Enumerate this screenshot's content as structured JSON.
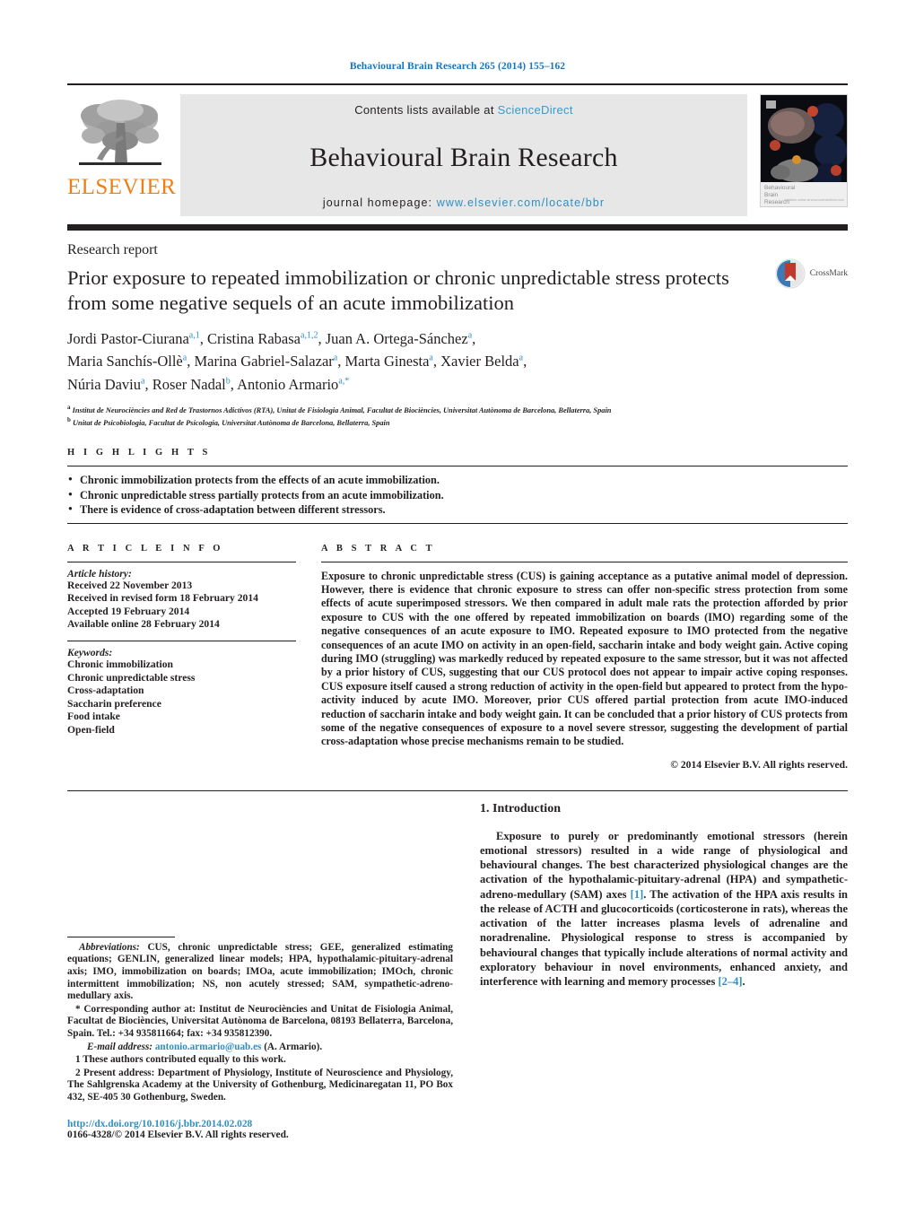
{
  "running_head": "Behavioural Brain Research 265 (2014) 155–162",
  "masthead": {
    "publisher_name": "ELSEVIER",
    "contents_prefix": "Contents lists available at ",
    "contents_link": "ScienceDirect",
    "journal_name": "Behavioural Brain Research",
    "homepage_prefix": "journal homepage: ",
    "homepage_url": "www.elsevier.com/locate/bbr",
    "cover_caption_line1": "Behavioural",
    "cover_caption_line2": "Brain",
    "cover_caption_line3": "Research",
    "cover_caption_tiny": "available online at www.sciencedirect.com"
  },
  "article": {
    "doc_type": "Research report",
    "title": "Prior exposure to repeated immobilization or chronic unpredictable stress protects from some negative sequels of an acute immobilization",
    "crossmark_label": "CrossMark",
    "authors": [
      {
        "name": "Jordi Pastor-Ciurana",
        "marks": "a,1",
        "sep": ", "
      },
      {
        "name": "Cristina Rabasa",
        "marks": "a,1,2",
        "sep": ", "
      },
      {
        "name": "Juan A. Ortega-Sánchez",
        "marks": "a",
        "sep": ","
      },
      {
        "name": "Maria Sanchís-Ollè",
        "marks": "a",
        "sep": ", "
      },
      {
        "name": "Marina Gabriel-Salazar",
        "marks": "a",
        "sep": ", "
      },
      {
        "name": "Marta Ginesta",
        "marks": "a",
        "sep": ", "
      },
      {
        "name": "Xavier Belda",
        "marks": "a",
        "sep": ","
      },
      {
        "name": "Núria Daviu",
        "marks": "a",
        "sep": ", "
      },
      {
        "name": "Roser Nadal",
        "marks": "b",
        "sep": ", "
      },
      {
        "name": "Antonio Armario",
        "marks": "a,*",
        "sep": ""
      }
    ],
    "affiliations": [
      {
        "mark": "a",
        "text": "Institut de Neurociències and Red de Trastornos Adictivos (RTA), Unitat de Fisiologia Animal, Facultat de Biociències, Universitat Autònoma de Barcelona, Bellaterra, Spain"
      },
      {
        "mark": "b",
        "text": "Unitat de Psicobiologia, Facultat de Psicologia, Universitat Autònoma de Barcelona, Bellaterra, Spain"
      }
    ]
  },
  "highlights": {
    "heading": "H I G H L I G H T S",
    "items": [
      "Chronic immobilization protects from the effects of an acute immobilization.",
      "Chronic unpredictable stress partially protects from an acute immobilization.",
      "There is evidence of cross-adaptation between different stressors."
    ]
  },
  "article_info": {
    "heading": "A R T I C L E   I N F O",
    "history_title": "Article history:",
    "history": [
      "Received 22 November 2013",
      "Received in revised form 18 February 2014",
      "Accepted 19 February 2014",
      "Available online 28 February 2014"
    ],
    "keywords_title": "Keywords:",
    "keywords": [
      "Chronic immobilization",
      "Chronic unpredictable stress",
      "Cross-adaptation",
      "Saccharin preference",
      "Food intake",
      "Open-field"
    ]
  },
  "abstract": {
    "heading": "A B S T R A C T",
    "text": "Exposure to chronic unpredictable stress (CUS) is gaining acceptance as a putative animal model of depression. However, there is evidence that chronic exposure to stress can offer non-specific stress protection from some effects of acute superimposed stressors. We then compared in adult male rats the protection afforded by prior exposure to CUS with the one offered by repeated immobilization on boards (IMO) regarding some of the negative consequences of an acute exposure to IMO. Repeated exposure to IMO protected from the negative consequences of an acute IMO on activity in an open-field, saccharin intake and body weight gain. Active coping during IMO (struggling) was markedly reduced by repeated exposure to the same stressor, but it was not affected by a prior history of CUS, suggesting that our CUS protocol does not appear to impair active coping responses. CUS exposure itself caused a strong reduction of activity in the open-field but appeared to protect from the hypo-activity induced by acute IMO. Moreover, prior CUS offered partial protection from acute IMO-induced reduction of saccharin intake and body weight gain. It can be concluded that a prior history of CUS protects from some of the negative consequences of exposure to a novel severe stressor, suggesting the development of partial cross-adaptation whose precise mechanisms remain to be studied.",
    "copyright": "© 2014 Elsevier B.V. All rights reserved."
  },
  "footnotes": {
    "abbreviations_label": "Abbreviations:",
    "abbreviations_text": " CUS, chronic unpredictable stress; GEE, generalized estimating equations; GENLIN, generalized linear models; HPA, hypothalamic-pituitary-adrenal axis; IMO, immobilization on boards; IMOa, acute immobilization; IMOch, chronic intermittent immobilization; NS, non acutely stressed; SAM, sympathetic-adreno-medullary axis.",
    "corresponding": "* Corresponding author at: Institut de Neurociències and Unitat de Fisiologia Animal, Facultat de Biociències, Universitat Autònoma de Barcelona, 08193 Bellaterra, Barcelona, Spain. Tel.: +34 935811664; fax: +34 935812390.",
    "email_label": "E-mail address:",
    "email": "antonio.armario@uab.es",
    "email_suffix": " (A. Armario).",
    "note1": "1  These authors contributed equally to this work.",
    "note2": "2  Present address: Department of Physiology, Institute of Neuroscience and Physiology, The Sahlgrenska Academy at the University of Gothenburg, Medicinaregatan 11, PO Box 432, SE-405 30 Gothenburg, Sweden."
  },
  "footer": {
    "doi": "http://dx.doi.org/10.1016/j.bbr.2014.02.028",
    "issn_line": "0166-4328/© 2014 Elsevier B.V. All rights reserved."
  },
  "introduction": {
    "heading": "1.  Introduction",
    "paragraph_part1": "Exposure to purely or predominantly emotional stressors (herein emotional stressors) resulted in a wide range of physiological and behavioural changes. The best characterized physiological changes are the activation of the hypothalamic-pituitary-adrenal (HPA) and sympathetic-adreno-medullary (SAM) axes ",
    "ref1": "[1]",
    "paragraph_part2": ". The activation of the HPA axis results in the release of ACTH and glucocorticoids (corticosterone in rats), whereas the activation of the latter increases plasma levels of adrenaline and noradrenaline. Physiological response to stress is accompanied by behavioural changes that typically include alterations of normal activity and exploratory behaviour in novel environments, enhanced anxiety, and interference with learning and memory processes ",
    "ref2": "[2–4]",
    "paragraph_part3": "."
  },
  "colors": {
    "link": "#2e8fc4",
    "brand_orange": "#f07f13",
    "rule": "#231f20",
    "band_gray": "#e7e7e7"
  }
}
